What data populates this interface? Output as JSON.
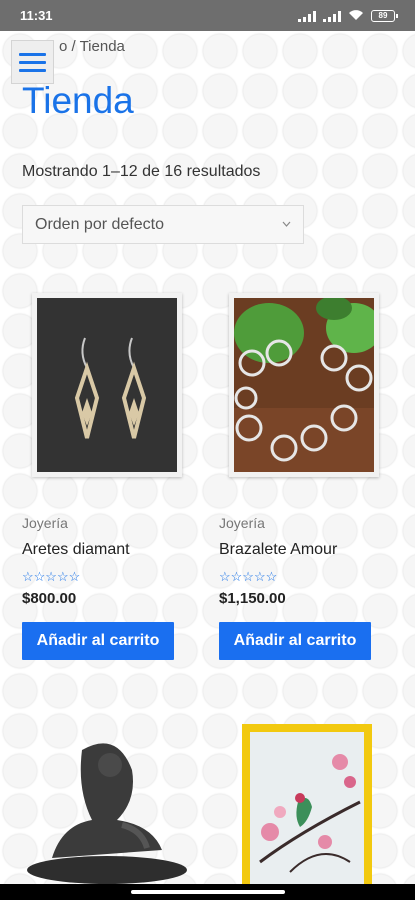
{
  "status": {
    "time": "11:31",
    "battery": "89"
  },
  "breadcrumb": "o / Tienda",
  "title": "Tienda",
  "result_count": "Mostrando 1–12 de 16 resultados",
  "orderby": {
    "selected": "Orden por defecto"
  },
  "products": [
    {
      "category": "Joyería",
      "name": "Aretes diamant",
      "rating": "☆☆☆☆☆",
      "price": "$800.00",
      "button": "Añadir al carrito"
    },
    {
      "category": "Joyería",
      "name": "Brazalete Amour",
      "rating": "☆☆☆☆☆",
      "price": "$1,150.00",
      "button": "Añadir al carrito"
    }
  ],
  "colors": {
    "accent": "#1a73e8",
    "button": "#1a6ff0"
  }
}
